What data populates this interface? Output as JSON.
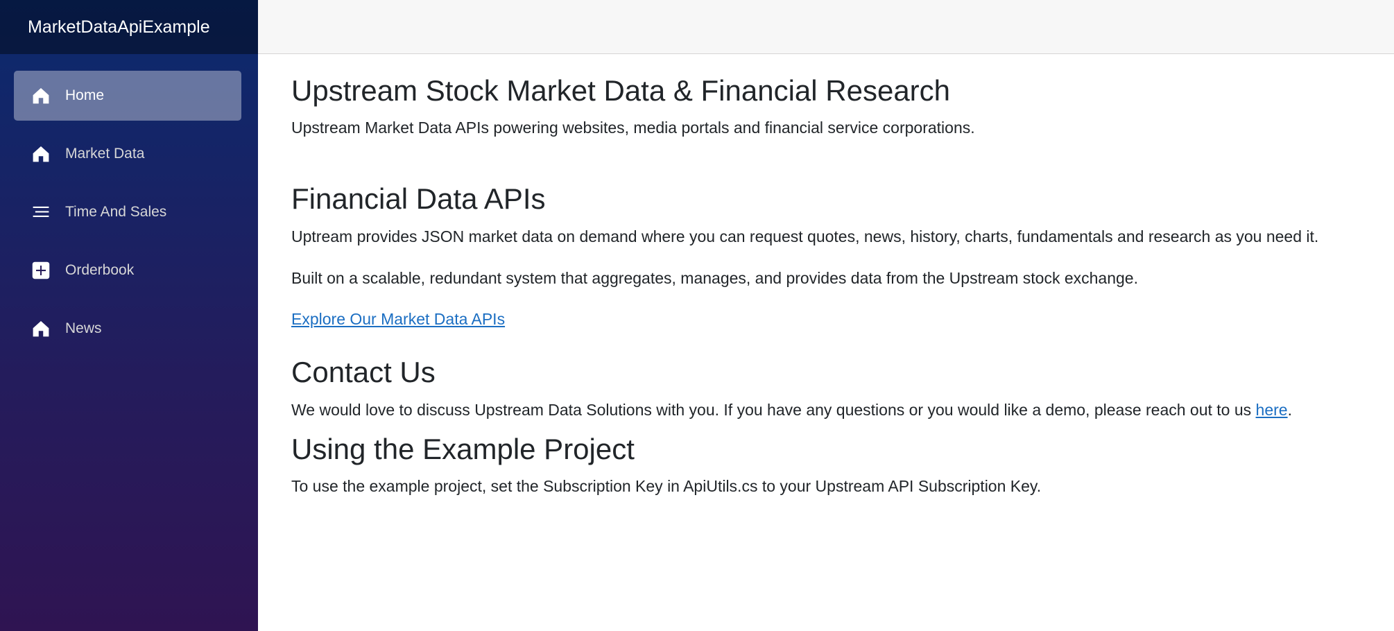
{
  "app": {
    "brand": "MarketDataApiExample"
  },
  "sidebar": {
    "items": [
      {
        "label": "Home",
        "icon": "home-icon",
        "active": true
      },
      {
        "label": "Market Data",
        "icon": "home-icon",
        "active": false
      },
      {
        "label": "Time And Sales",
        "icon": "list-icon",
        "active": false
      },
      {
        "label": "Orderbook",
        "icon": "plus-icon",
        "active": false
      },
      {
        "label": "News",
        "icon": "home-icon",
        "active": false
      }
    ]
  },
  "main": {
    "title": "Upstream Stock Market Data & Financial Research",
    "subtitle": "Upstream Market Data APIs powering websites, media portals and financial service corporations.",
    "sections": {
      "apis": {
        "heading": "Financial Data APIs",
        "para1": "Uptream provides JSON market data on demand where you can request quotes, news, history, charts, fundamentals and research as you need it.",
        "para2": "Built on a scalable, redundant system that aggregates, manages, and provides data from the Upstream stock exchange.",
        "link": "Explore Our Market Data APIs"
      },
      "contact": {
        "heading": "Contact Us",
        "text_before": "We would love to discuss Upstream Data Solutions with you. If you have any questions or you would like a demo, please reach out to us ",
        "link": "here",
        "text_after": "."
      },
      "example": {
        "heading": "Using the Example Project",
        "text": "To use the example project, set the Subscription Key in ApiUtils.cs to your Upstream API Subscription Key."
      }
    }
  },
  "colors": {
    "sidebar_top": "#0b2a6e",
    "sidebar_bottom": "#2f1452",
    "link": "#1b6ec2",
    "top_row_bg": "#f7f7f7"
  }
}
